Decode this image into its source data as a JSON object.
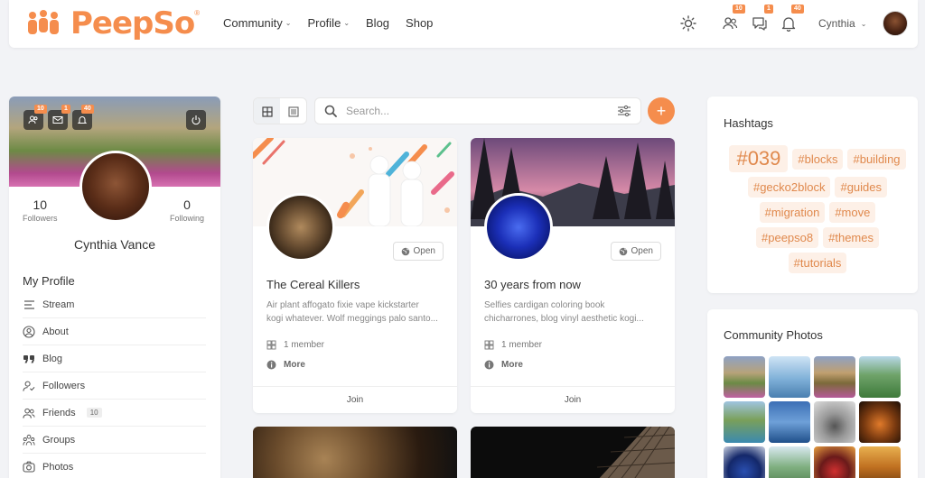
{
  "brand": {
    "name": "PeepSo",
    "reg": "®",
    "color": "#f58d4d"
  },
  "nav": [
    {
      "label": "Community",
      "dropdown": true
    },
    {
      "label": "Profile",
      "dropdown": true
    },
    {
      "label": "Blog",
      "dropdown": false
    },
    {
      "label": "Shop",
      "dropdown": false
    }
  ],
  "header": {
    "theme_icon": "sun-icon",
    "friends_badge": "10",
    "messages_badge": "1",
    "notifications_badge": "40",
    "user_name": "Cynthia"
  },
  "profile": {
    "badges": {
      "friends": "10",
      "messages": "1",
      "notifications": "40"
    },
    "followers_count": "10",
    "followers_label": "Followers",
    "following_count": "0",
    "following_label": "Following",
    "name": "Cynthia Vance",
    "menu_title": "My Profile",
    "menu": [
      {
        "label": "Stream",
        "icon": "stream-icon"
      },
      {
        "label": "About",
        "icon": "user-circle-icon"
      },
      {
        "label": "Blog",
        "icon": "quote-icon"
      },
      {
        "label": "Followers",
        "icon": "user-check-icon"
      },
      {
        "label": "Friends",
        "icon": "users-icon",
        "count": "10"
      },
      {
        "label": "Groups",
        "icon": "groups-icon"
      },
      {
        "label": "Photos",
        "icon": "camera-icon"
      }
    ]
  },
  "search": {
    "placeholder": "Search..."
  },
  "groups": [
    {
      "title": "The Cereal Killers",
      "privacy": "Open",
      "desc1": "Air plant affogato fixie vape kickstarter",
      "desc2": "kogi whatever. Wolf meggings palo santo...",
      "members": "1 member",
      "more": "More",
      "join": "Join"
    },
    {
      "title": "30 years from now",
      "privacy": "Open",
      "desc1": "Selfies cardigan coloring book",
      "desc2": "chicharrones, blog vinyl aesthetic kogi...",
      "members": "1 member",
      "more": "More",
      "join": "Join"
    }
  ],
  "hashtags": {
    "title": "Hashtags",
    "tags": [
      "#039",
      "#blocks",
      "#building",
      "#gecko2block",
      "#guides",
      "#migration",
      "#move",
      "#peepso8",
      "#themes",
      "#tutorials"
    ]
  },
  "community_photos": {
    "title": "Community Photos"
  }
}
